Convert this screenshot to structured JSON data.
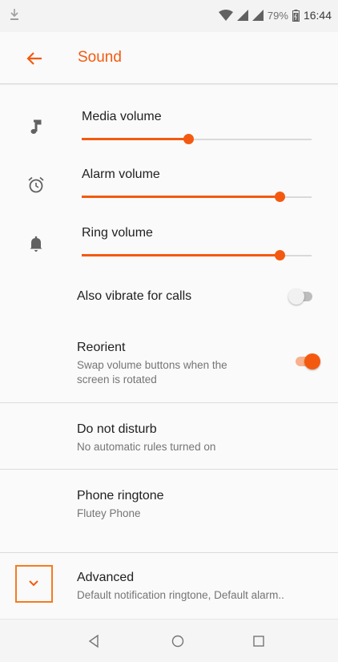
{
  "status_bar": {
    "battery": "79%",
    "time": "16:44",
    "icons": [
      "download-icon",
      "wifi-icon",
      "signal-icon",
      "signal-icon",
      "battery-icon"
    ]
  },
  "app_bar": {
    "title": "Sound",
    "back_icon": "back-arrow-icon"
  },
  "colors": {
    "accent": "#f45a0f",
    "accent_light": "#f8b18c",
    "text_primary": "#212121",
    "text_secondary": "#757575",
    "icon": "#616161"
  },
  "volumes": [
    {
      "label": "Media volume",
      "icon": "music-note-icon",
      "level": 0.465
    },
    {
      "label": "Alarm volume",
      "icon": "alarm-clock-icon",
      "level": 0.86
    },
    {
      "label": "Ring volume",
      "icon": "bell-icon",
      "level": 0.86
    }
  ],
  "vibrate": {
    "title": "Also vibrate for calls",
    "enabled": false
  },
  "reorient": {
    "title": "Reorient",
    "subtitle_line1": "Swap volume buttons when the",
    "subtitle_line2": "screen is rotated",
    "enabled": true
  },
  "do_not_disturb": {
    "title": "Do not disturb",
    "subtitle": "No automatic rules turned on"
  },
  "ringtone": {
    "title": "Phone ringtone",
    "subtitle": "Flutey Phone"
  },
  "advanced": {
    "title": "Advanced",
    "subtitle": "Default notification ringtone, Default alarm.."
  },
  "nav_bar": [
    "back-triangle-icon",
    "home-circle-icon",
    "recents-square-icon"
  ]
}
